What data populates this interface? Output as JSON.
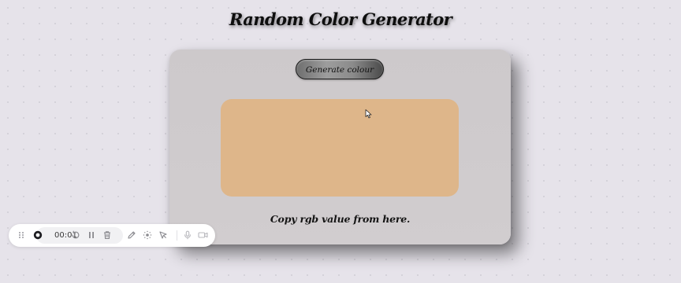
{
  "app": {
    "title": "Random Color Generator"
  },
  "generator": {
    "button_label": "Generate colour",
    "swatch_color": "#deb68a",
    "copy_label": "Copy rgb value from here."
  },
  "recorder_toolbar": {
    "elapsed_time": "00:01",
    "icons": [
      "drag-handle-icon",
      "record-icon",
      "restart-icon",
      "pause-icon",
      "trash-icon",
      "pen-icon",
      "focus-icon",
      "pointer-icon",
      "microphone-icon",
      "camera-icon"
    ]
  },
  "colors": {
    "page_background": "#e6e3ea",
    "card_background": "#cfcbcd",
    "title_text": "#0e0e0e",
    "toolbar_background": "#ffffff",
    "toolbar_icon": "#8a8a8f"
  }
}
